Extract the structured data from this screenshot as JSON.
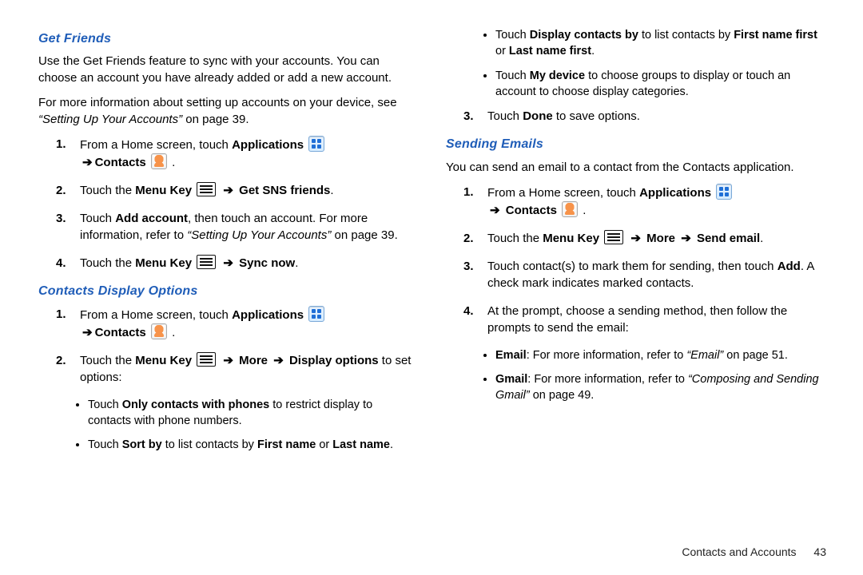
{
  "left": {
    "getFriends": {
      "title": "Get Friends",
      "para1": "Use the Get Friends feature to sync with your accounts. You can choose an account you have already added or add a new account.",
      "para2a": "For more information about setting up accounts on your device, see ",
      "para2ref": "“Setting Up Your Accounts”",
      "para2b": " on page 39.",
      "s1a": "From a Home screen, touch ",
      "apps": "Applications",
      "contacts": "Contacts",
      "period": ".",
      "s2a": "Touch the ",
      "menuKey": "Menu Key",
      "s2b": "Get SNS friends",
      "s3a": "Touch ",
      "addAcct": "Add account",
      "s3b": ", then touch an account. For more information, refer to ",
      "s3ref": "“Setting Up Your Accounts”",
      "s3c": "  on page 39.",
      "s4b": "Sync now"
    },
    "displayOptions": {
      "title": "Contacts Display Options",
      "s1a": "From a Home screen, touch ",
      "s2a": "Touch the ",
      "more": "More",
      "disp": "Display options",
      "s2b": " to set options:",
      "b1a": "Touch ",
      "b1b": "Only contacts with phones",
      "b1c": " to restrict display to contacts with phone numbers.",
      "b2a": "Touch ",
      "b2b": "Sort by",
      "b2c": " to list contacts by ",
      "fn": "First name",
      "or": " or ",
      "ln": "Last name",
      "dot": "."
    }
  },
  "right": {
    "topBullets": {
      "b1a": "Touch ",
      "b1b": "Display contacts by",
      "b1c": " to list contacts by ",
      "b1d": "First name first",
      "b1e": " or ",
      "b1f": "Last name first",
      "b1g": ".",
      "b2a": "Touch ",
      "b2b": "My device",
      "b2c": " to choose groups to display or touch an account to choose display categories."
    },
    "step3a": "Touch ",
    "done": "Done",
    "step3b": " to save options.",
    "sending": {
      "title": "Sending Emails",
      "intro": "You can send an email to a contact from the Contacts application.",
      "s1a": "From a Home screen, touch ",
      "apps": "Applications",
      "contacts": "Contacts",
      "s2a": "Touch the ",
      "menuKey": "Menu Key",
      "more": "More",
      "sendEmail": "Send email",
      "s3": "Touch contact(s) to mark them for sending, then touch ",
      "add": "Add",
      "s3b": ". A check mark indicates marked contacts.",
      "s4": "At the prompt, choose a sending method, then follow the prompts to send the email:",
      "eb1a": "Email",
      "eb1b": ": For more information, refer to ",
      "eb1ref": "“Email”",
      "eb1c": "  on page 51.",
      "eb2a": "Gmail",
      "eb2b": ": For more information, refer to ",
      "eb2ref": "“Composing and Sending Gmail”",
      "eb2c": "  on page 49."
    }
  },
  "footer": {
    "label": "Contacts and Accounts",
    "page": "43"
  },
  "glyph": {
    "arrow": "➔"
  }
}
